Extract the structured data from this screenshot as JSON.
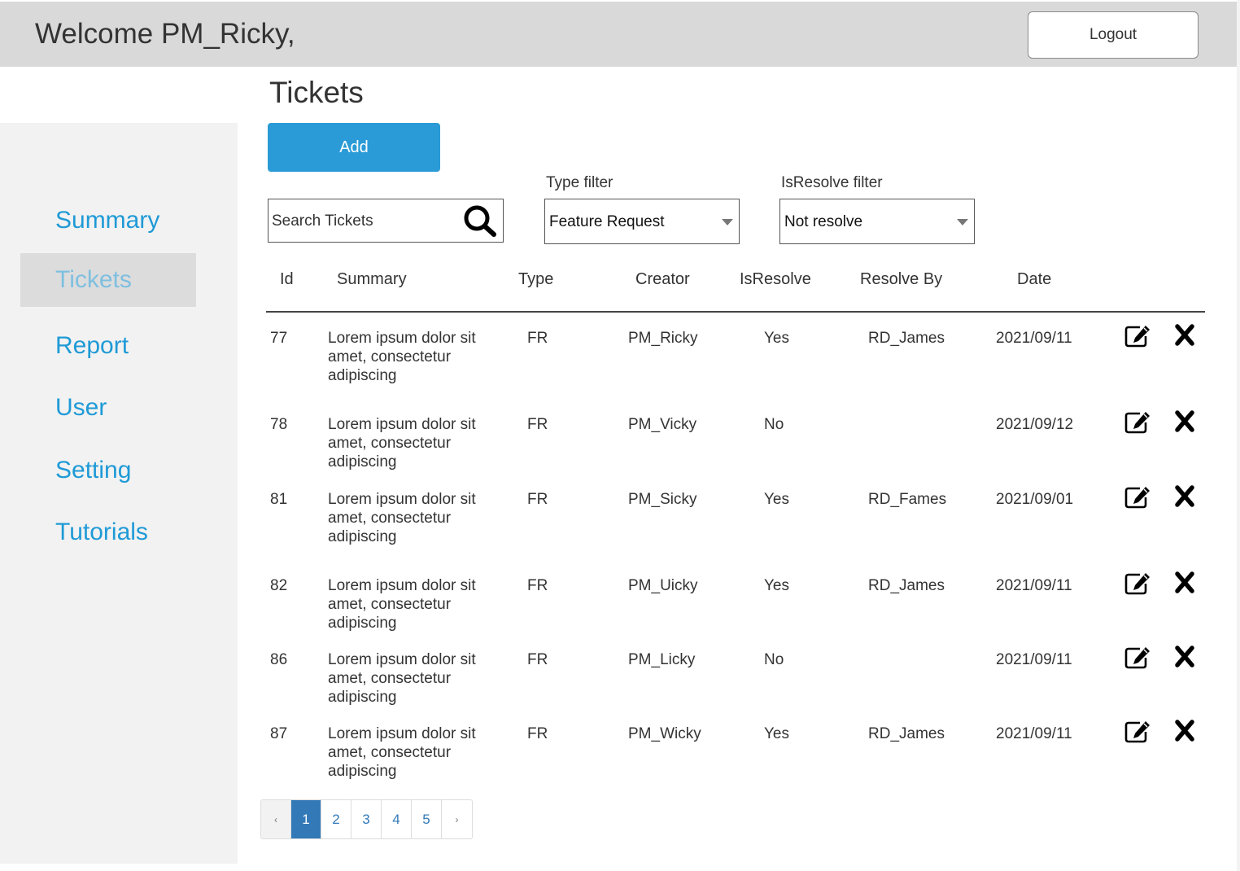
{
  "header": {
    "welcome": "Welcome PM_Ricky,",
    "logout_label": "Logout"
  },
  "sidebar": {
    "items": [
      {
        "label": "Summary",
        "active": false
      },
      {
        "label": "Tickets",
        "active": true
      },
      {
        "label": "Report",
        "active": false
      },
      {
        "label": "User",
        "active": false
      },
      {
        "label": "Setting",
        "active": false
      },
      {
        "label": "Tutorials",
        "active": false
      }
    ]
  },
  "main": {
    "title": "Tickets",
    "add_label": "Add",
    "search": {
      "value": "Search Tickets",
      "placeholder": "Search Tickets",
      "icon": "search-icon"
    },
    "type_filter": {
      "label": "Type filter",
      "value": "Feature Request"
    },
    "resolve_filter": {
      "label": "IsResolve filter",
      "value": "Not resolve"
    }
  },
  "table": {
    "columns": [
      "Id",
      "Summary",
      "Type",
      "Creator",
      "IsResolve",
      "Resolve By",
      "Date"
    ],
    "rows": [
      {
        "id": "77",
        "summary": "Lorem ipsum dolor sit amet, consectetur adipiscing",
        "type": "FR",
        "creator": "PM_Ricky",
        "resolved": "Yes",
        "resolve_by": "RD_James",
        "date": "2021/09/11"
      },
      {
        "id": "78",
        "summary": "Lorem ipsum dolor sit amet, consectetur adipiscing",
        "type": "FR",
        "creator": "PM_Vicky",
        "resolved": "No",
        "resolve_by": "",
        "date": "2021/09/12"
      },
      {
        "id": "81",
        "summary": "Lorem ipsum dolor sit amet, consectetur adipiscing",
        "type": "FR",
        "creator": "PM_Sicky",
        "resolved": "Yes",
        "resolve_by": "RD_Fames",
        "date": "2021/09/01"
      },
      {
        "id": "82",
        "summary": "Lorem ipsum dolor sit amet, consectetur adipiscing",
        "type": "FR",
        "creator": "PM_Uicky",
        "resolved": "Yes",
        "resolve_by": "RD_James",
        "date": "2021/09/11"
      },
      {
        "id": "86",
        "summary": "Lorem ipsum dolor sit amet, consectetur adipiscing",
        "type": "FR",
        "creator": "PM_Licky",
        "resolved": "No",
        "resolve_by": "",
        "date": "2021/09/11"
      },
      {
        "id": "87",
        "summary": "Lorem ipsum dolor sit amet, consectetur adipiscing",
        "type": "FR",
        "creator": "PM_Wicky",
        "resolved": "Yes",
        "resolve_by": "RD_James",
        "date": "2021/09/11"
      }
    ],
    "row_icons": [
      "edit-icon",
      "delete-icon"
    ]
  },
  "pagination": {
    "prev": "‹",
    "next": "›",
    "pages": [
      "1",
      "2",
      "3",
      "4",
      "5"
    ],
    "current": "1"
  },
  "colors": {
    "accent": "#2a9bd6",
    "nav_link": "#1f9ad6",
    "nav_active_text": "#7fbfe0",
    "header_bg": "#d9d9d9",
    "sidebar_bg": "#f2f2f2",
    "page_active": "#3379b7"
  }
}
